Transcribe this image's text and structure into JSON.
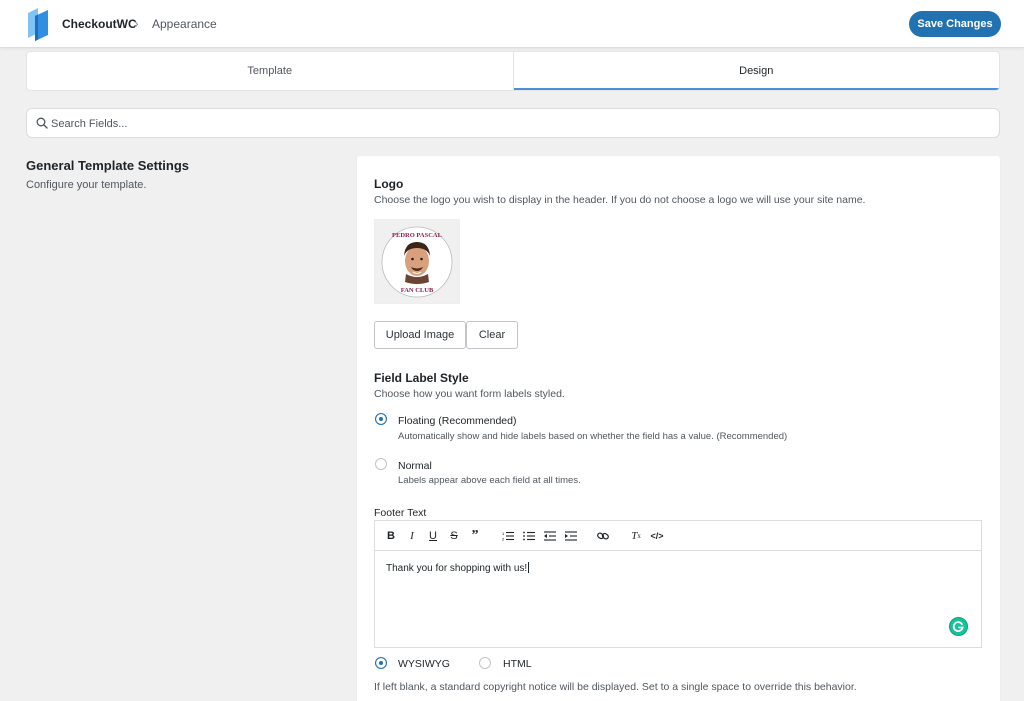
{
  "app": {
    "brand": "CheckoutWC",
    "breadcrumb_sep": "›",
    "page": "Appearance",
    "save_label": "Save Changes"
  },
  "tabs": [
    {
      "label": "Template",
      "active": false
    },
    {
      "label": "Design",
      "active": true
    }
  ],
  "search": {
    "placeholder": "Search Fields...",
    "value": ""
  },
  "section": {
    "title": "General Template Settings",
    "description": "Configure your template."
  },
  "logo_field": {
    "title": "Logo",
    "description": "Choose the logo you wish to display in the header. If you do not choose a logo we will use your site name.",
    "image_text_top": "PEDRO PASCAL",
    "image_text_bottom": "FAN CLUB",
    "upload_label": "Upload Image",
    "clear_label": "Clear"
  },
  "label_style": {
    "title": "Field Label Style",
    "description": "Choose how you want form labels styled.",
    "options": [
      {
        "label": "Floating (Recommended)",
        "help": "Automatically show and hide labels based on whether the field has a value. (Recommended)",
        "checked": true
      },
      {
        "label": "Normal",
        "help": "Labels appear above each field at all times.",
        "checked": false
      }
    ]
  },
  "footer_text": {
    "title": "Footer Text",
    "toolbar": [
      "bold-icon",
      "italic-icon",
      "underline-icon",
      "strikethrough-icon",
      "blockquote-icon",
      "ordered-list-icon",
      "bullet-list-icon",
      "outdent-icon",
      "indent-icon",
      "link-icon",
      "clear-format-icon",
      "code-icon"
    ],
    "content": "Thank you for shopping with us!",
    "modes": [
      {
        "label": "WYSIWYG",
        "checked": true
      },
      {
        "label": "HTML",
        "checked": false
      }
    ],
    "help": "If left blank, a standard copyright notice will be displayed. Set to a single space to override this behavior."
  },
  "colors": {
    "accent": "#2271b1",
    "tab_underline": "#4a90d9",
    "page_bg": "#f0f0f1",
    "grammarly": "#15c39a"
  }
}
